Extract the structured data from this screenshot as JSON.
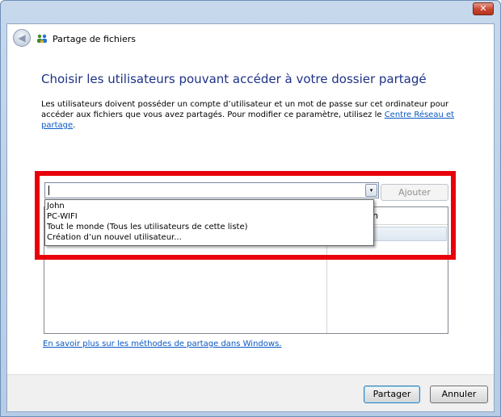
{
  "window": {
    "title": "Partage de fichiers",
    "close_glyph": "✕"
  },
  "nav": {
    "back_glyph": "◀"
  },
  "heading": "Choisir les utilisateurs pouvant accéder à votre dossier partagé",
  "description": {
    "text": "Les utilisateurs doivent posséder un compte d’utilisateur et un mot de passe sur cet ordinateur pour accéder aux fichiers que vous avez partagés. Pour modifier ce paramètre, utilisez le ",
    "link": "Centre Réseau et partage",
    "suffix": "."
  },
  "user_combo": {
    "value": "",
    "arrow_glyph": "▾"
  },
  "add_button": "Ajouter",
  "dropdown": {
    "items": [
      "John",
      "PC-WIFI",
      "Tout le monde (Tous les utilisateurs de cette liste)",
      "Création d’un nouvel utilisateur..."
    ]
  },
  "table": {
    "column_partial": "utorisation",
    "cell_partial": "e ▼"
  },
  "learn_link": "En savoir plus sur les méthodes de partage dans Windows.",
  "footer": {
    "share_button": "Partager",
    "cancel_button": "Annuler"
  },
  "colors": {
    "heading": "#1e3287",
    "link": "#0a58c4",
    "highlight": "#e8000b"
  }
}
